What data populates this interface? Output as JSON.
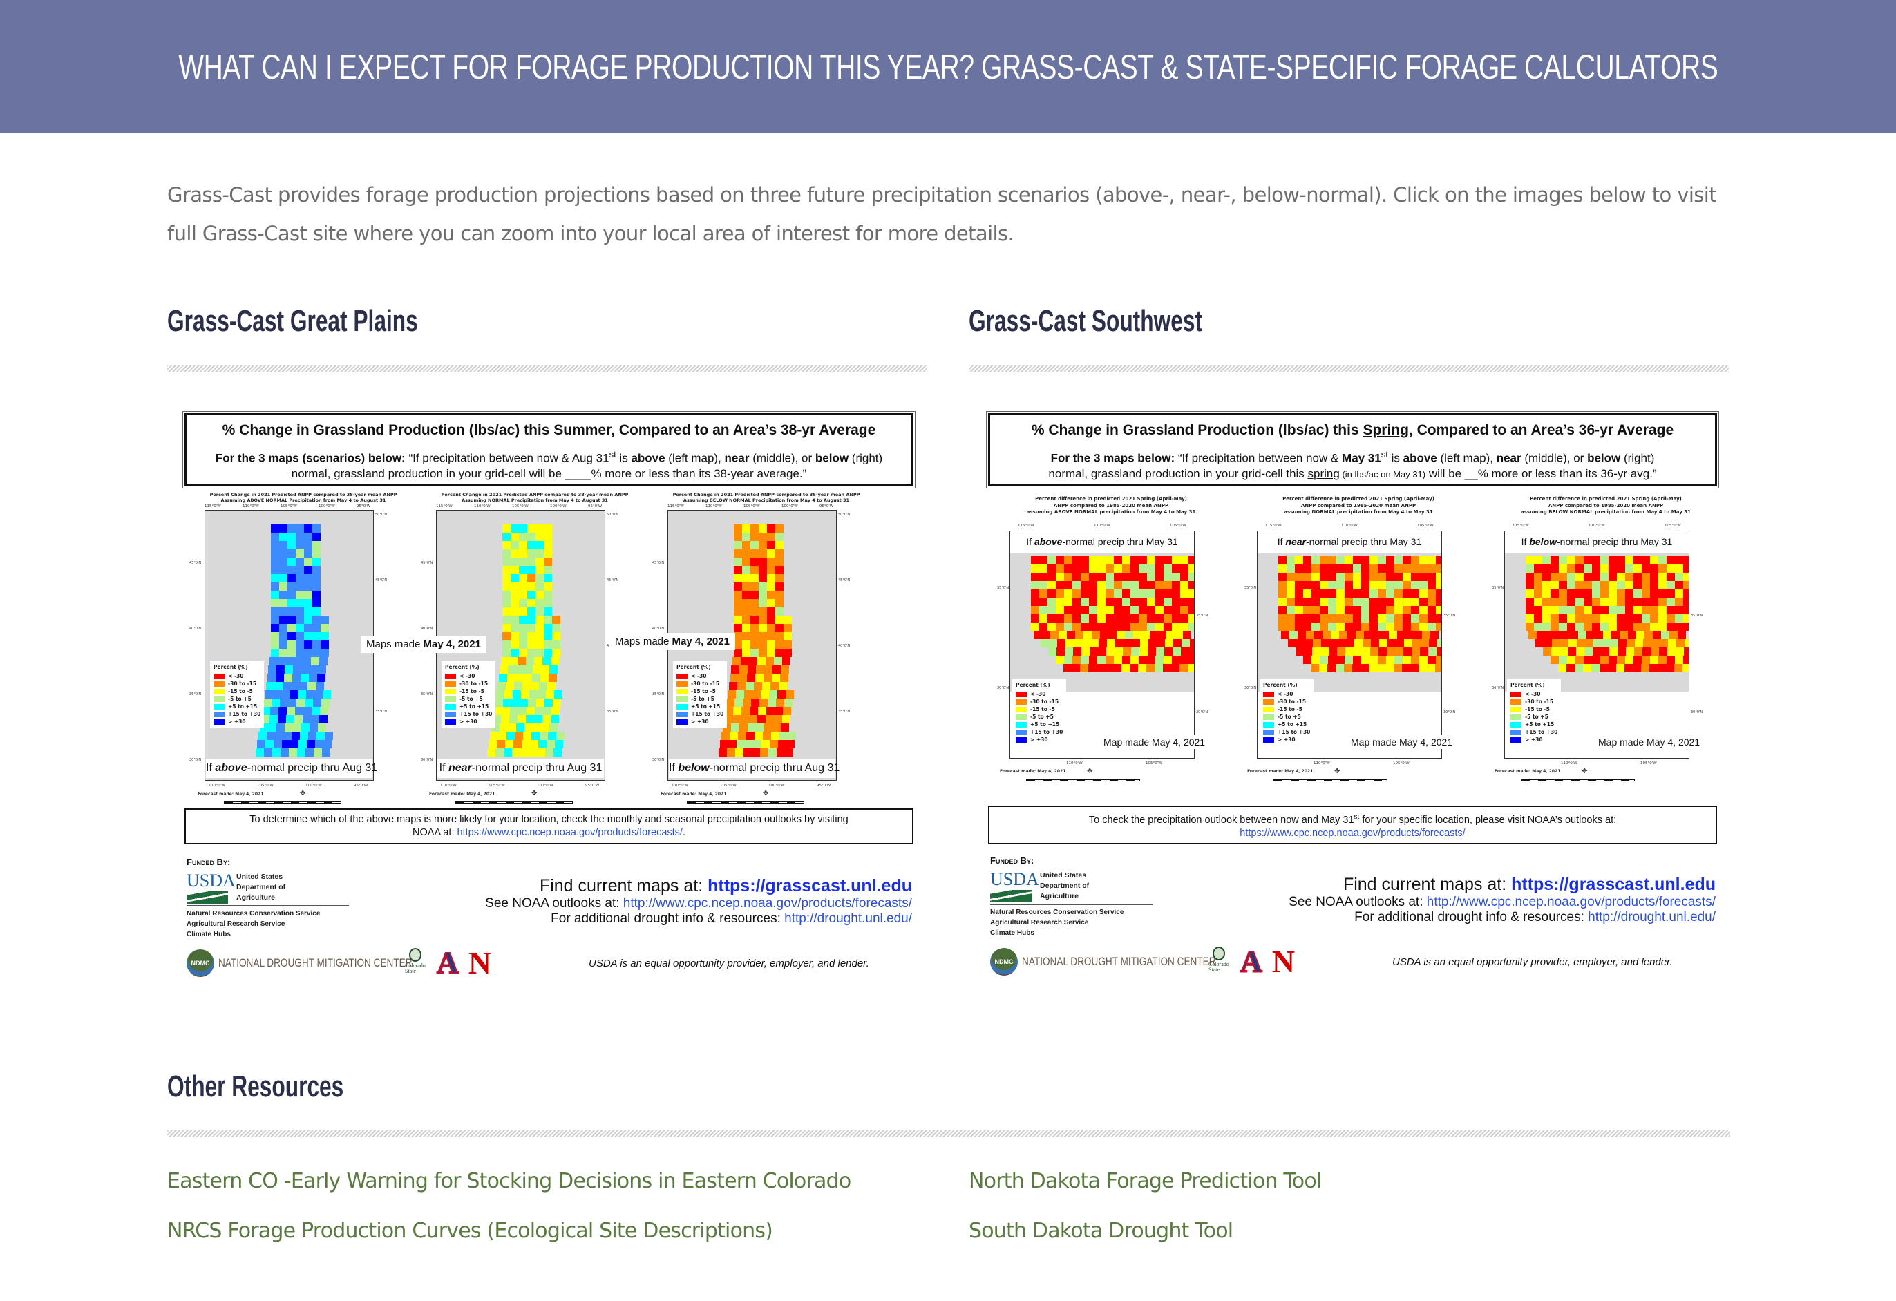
{
  "banner": {
    "title": "WHAT CAN I EXPECT FOR FORAGE PRODUCTION THIS YEAR? GRASS-CAST & STATE-SPECIFIC FORAGE CALCULATORS",
    "background_color": "#6b74a1"
  },
  "intro": {
    "text": "Grass-Cast provides forage production projections based on three future precipitation scenarios (above-, near-, below-normal). Click on the images below to visit full Grass-Cast site where you can zoom into your local area of interest for more details."
  },
  "legend": {
    "title": "Percent (%)",
    "items": [
      {
        "label": "< -30",
        "color": "#ff0000"
      },
      {
        "label": "-30 to -15",
        "color": "#ff8c00"
      },
      {
        "label": "-15 to -5",
        "color": "#ffff00"
      },
      {
        "label": "-5 to +5",
        "color": "#b4f08c"
      },
      {
        "label": "+5 to +15",
        "color": "#00ffff"
      },
      {
        "label": "+15 to +30",
        "color": "#3c8cff"
      },
      {
        "label": "> +30",
        "color": "#0000ff"
      }
    ]
  },
  "great_plains": {
    "section_title": "Grass-Cast Great Plains",
    "header_title": "% Change in Grassland Production (lbs/ac) this Summer, Compared to an Area’s 38-yr Average",
    "header_lead": "For the 3 maps (scenarios) below:",
    "header_q1": " “If precipitation between now & Aug 31",
    "header_sup": "st",
    "header_q2": " is ",
    "above": "above",
    "left_map": " (left map), ",
    "near": "near",
    "middle": " (middle), or ",
    "below": "below",
    "right_tail": " (right) normal, grassland production in your grid-cell will be ____% more or less than its 38-year average.”",
    "made_prefix": "Maps made ",
    "made_date": "May 4, 2021",
    "forecast_made": "Forecast made: May 4, 2021",
    "lon_top": [
      "115°0'W",
      "110°0'W",
      "105°0'W",
      "100°0'W",
      "95°0'W"
    ],
    "lon_bottom": [
      "110°0'W",
      "105°0'W",
      "100°0'W",
      "95°0'W"
    ],
    "lat_left": [
      "45°0'N",
      "40°0'N",
      "35°0'N",
      "30°0'N"
    ],
    "lat_right": [
      "50°0'N",
      "45°0'N",
      "40°0'N",
      "35°0'N"
    ],
    "maps": [
      {
        "caption_1": "Percent Change in 2021 Predicted ANPP compared to 38-year mean ANPP",
        "caption_2": "Assuming ABOVE NORMAL Precipitation from May 4 to August 31",
        "label_pre": "If ",
        "label_em": "above",
        "label_post": "-normal precip thru Aug 31",
        "dominant_colors": [
          "#3c8cff",
          "#00ffff",
          "#b4f08c",
          "#0000ff"
        ]
      },
      {
        "caption_1": "Percent Change in 2021 Predicted ANPP compared to 38-year mean ANPP",
        "caption_2": "Assuming NORMAL Precipitation from May 4 to August 31",
        "label_pre": "If ",
        "label_em": "near",
        "label_post": "-normal precip thru Aug 31",
        "dominant_colors": [
          "#ffff00",
          "#b4f08c",
          "#00ffff",
          "#ff8c00"
        ]
      },
      {
        "caption_1": "Percent Change in 2021 Predicted ANPP compared to 38-year mean ANPP",
        "caption_2": "Assuming BELOW NORMAL Precipitation from May 4 to August 31",
        "label_pre": "If ",
        "label_em": "below",
        "label_post": "-normal precip thru Aug 31",
        "dominant_colors": [
          "#ff8c00",
          "#ff0000",
          "#ffff00",
          "#b4f08c"
        ]
      }
    ],
    "footer_note_1": "To determine which of the above maps is more likely for your location, check the monthly and seasonal precipitation outlooks by visiting",
    "footer_note_2": "NOAA at: ",
    "footer_note_link": "https://www.cpc.ncep.noaa.gov/products/forecasts/",
    "footer_note_end": "."
  },
  "southwest": {
    "section_title": "Grass-Cast Southwest",
    "header_title_pre": "% Change in Grassland Production (lbs/ac) this ",
    "header_title_ul": "Spring",
    "header_title_post": ", Compared to an Area’s 36-yr Average",
    "header_lead": "For the 3 maps below:",
    "header_q1": " “If precipitation between now & ",
    "header_may": "May 31",
    "header_sup": "st",
    "header_q2": " is ",
    "above": "above",
    "left_map": " (left map), ",
    "near": "near",
    "middle": " (middle), or ",
    "below": "below",
    "right_part": " (right)",
    "line2_pre": "normal, grassland production in your grid-cell this ",
    "line2_ul": "spring",
    "line2_small": " (in lbs/ac on May 31)",
    "line2_post": " will be __% more or less than its 36-yr avg.”",
    "made_label": "Map made May 4, 2021",
    "forecast_made": "Forecast made: May 4, 2021",
    "lon_top": [
      "115°0'W",
      "110°0'W",
      "105°0'W"
    ],
    "lon_bottom": [
      "110°0'W",
      "105°0'W"
    ],
    "lat_left": [
      "35°0'N",
      "30°0'N"
    ],
    "lat_right": [
      "35°0'N",
      "30°0'N"
    ],
    "maps": [
      {
        "caption_1": "Percent difference in predicted 2021 Spring (April-May)",
        "caption_2": "ANPP compared to 1985-2020 mean ANPP",
        "caption_3": "assuming ABOVE NORMAL precipitation from May 4 to May 31",
        "label_pre": "If ",
        "label_em": "above",
        "label_post": "-normal precip thru May 31",
        "dominant_colors": [
          "#ff0000",
          "#ffff00",
          "#b4f08c",
          "#ff8c00"
        ]
      },
      {
        "caption_1": "Percent difference in predicted 2021 Spring (April-May)",
        "caption_2": "ANPP compared to 1985-2020 mean ANPP",
        "caption_3": "assuming NORMAL precipitation from May 4 to May 31",
        "label_pre": "If ",
        "label_em": "near",
        "label_post": "-normal precip thru May 31",
        "dominant_colors": [
          "#ff0000",
          "#ff8c00",
          "#ffff00",
          "#b4f08c"
        ]
      },
      {
        "caption_1": "Percent difference in predicted 2021 Spring (April-May)",
        "caption_2": "ANPP compared to 1985-2020 mean ANPP",
        "caption_3": "assuming BELOW NORMAL precipitation from May 4 to May 31",
        "label_pre": "If ",
        "label_em": "below",
        "label_post": "-normal precip thru May 31",
        "dominant_colors": [
          "#ff0000",
          "#ff8c00",
          "#ffff00",
          "#b4f08c"
        ]
      }
    ],
    "footer_note_1": "To check the precipitation outlook between now and May 31",
    "footer_note_sup": "st",
    "footer_note_1b": " for your specific location, please visit NOAA’s outlooks at:",
    "footer_note_link": "https://www.cpc.ncep.noaa.gov/products/forecasts/"
  },
  "poster_footer": {
    "funded_by": "Funded By:",
    "usda_word": "USDA",
    "usda_dept": [
      "United States",
      "Department of",
      "Agriculture"
    ],
    "usda_agencies": [
      "Natural Resources Conservation Service",
      "Agricultural Research Service",
      "Climate Hubs"
    ],
    "find_maps_prefix": "Find current maps at: ",
    "find_maps_link": "https://grasscast.unl.edu",
    "noaa_prefix": "See NOAA outlooks at: ",
    "noaa_link": "http://www.cpc.ncep.noaa.gov/products/forecasts/",
    "drought_prefix": "For additional drought info & resources:  ",
    "drought_link": "http://drought.unl.edu/",
    "ndmc_badge": "NDMC",
    "ndmc_name": "NATIONAL DROUGHT MITIGATION CENTER",
    "csu_name": "Colorado State",
    "ua_letter": "A",
    "neb_letter": "N",
    "eeo": "USDA is an equal opportunity provider, employer, and lender."
  },
  "other_resources": {
    "section_title": "Other Resources",
    "link_color": "#5a7a3f",
    "links": [
      "Eastern CO -Early Warning for Stocking Decisions in Eastern Colorado",
      "North Dakota Forage Prediction Tool",
      "NRCS Forage Production Curves (Ecological Site Descriptions)",
      "South Dakota Drought Tool"
    ]
  }
}
